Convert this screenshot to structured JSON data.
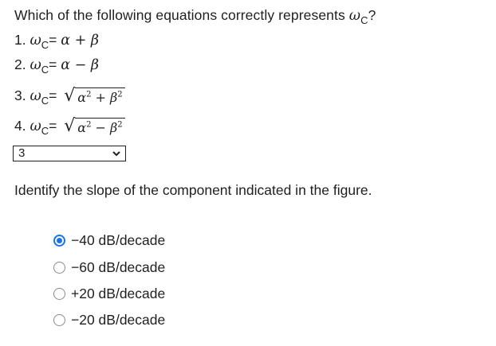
{
  "question1": {
    "text": "Which of the following equations correctly represents ",
    "symbol": "ω",
    "subscript": "C",
    "end": "?",
    "equations": [
      {
        "num": "1. ",
        "expr": "α + β"
      },
      {
        "num": "2. ",
        "expr": "α − β"
      },
      {
        "num": "3. ",
        "radicand_a": "α",
        "op": " + ",
        "radicand_b": "β",
        "power": "2"
      },
      {
        "num": "4. ",
        "radicand_a": "α",
        "op": " − ",
        "radicand_b": "β",
        "power": "2"
      }
    ],
    "equals": "= ",
    "answer_value": "3"
  },
  "question2": {
    "text": "Identify the slope of the component indicated in the figure.",
    "options": [
      {
        "label": "−40 dB/decade",
        "selected": true
      },
      {
        "label": "−60 dB/decade",
        "selected": false
      },
      {
        "label": "+20 dB/decade",
        "selected": false
      },
      {
        "label": "−20 dB/decade",
        "selected": false
      }
    ]
  },
  "colors": {
    "accent": "#1a73e8",
    "text": "#1f1f1f"
  }
}
